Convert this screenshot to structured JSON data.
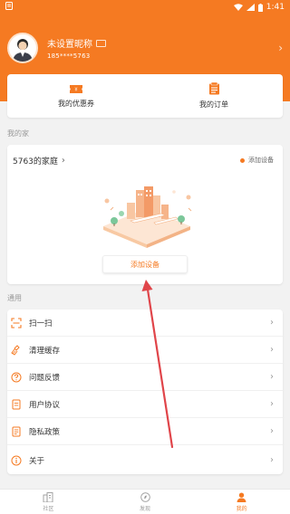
{
  "status_bar": {
    "time": "1:41"
  },
  "profile": {
    "nickname": "未设置昵称",
    "phone": "185****5763"
  },
  "quick_actions": [
    {
      "label": "我的优惠券",
      "icon": "coupon-icon"
    },
    {
      "label": "我的订单",
      "icon": "order-icon"
    }
  ],
  "home_section": {
    "title": "我的家",
    "home_name": "5763的家庭",
    "add_device_top": "添加设备",
    "add_device_button": "添加设备"
  },
  "general_section": {
    "title": "通用",
    "items": [
      {
        "label": "扫一扫",
        "icon": "scan-icon"
      },
      {
        "label": "清理缓存",
        "icon": "broom-icon"
      },
      {
        "label": "问题反馈",
        "icon": "question-icon"
      },
      {
        "label": "用户协议",
        "icon": "document-icon"
      },
      {
        "label": "隐私政策",
        "icon": "privacy-icon"
      },
      {
        "label": "关于",
        "icon": "info-icon"
      }
    ]
  },
  "bottom_nav": [
    {
      "label": "社区",
      "icon": "community-icon",
      "active": false
    },
    {
      "label": "发现",
      "icon": "discover-icon",
      "active": false
    },
    {
      "label": "我的",
      "icon": "profile-icon",
      "active": true
    }
  ],
  "colors": {
    "accent": "#f57a22",
    "annotation_arrow": "#e0454a"
  }
}
